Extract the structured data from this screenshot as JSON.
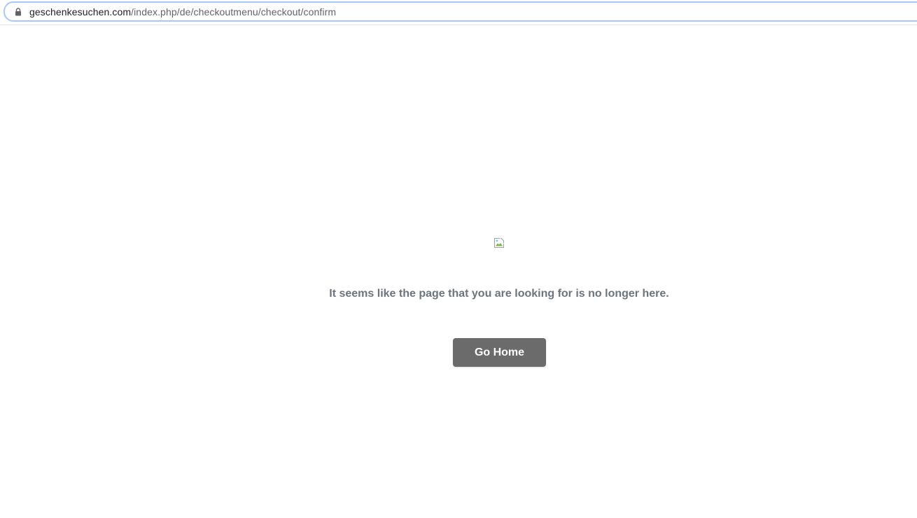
{
  "browser": {
    "url_host": "geschenkesuchen.com",
    "url_path": "/index.php/de/checkoutmenu/checkout/confirm",
    "lock_icon": "lock-icon"
  },
  "error_page": {
    "image_icon": "broken-image-icon",
    "message": "It seems like the page that you are looking for is no longer here.",
    "go_home_label": "Go Home",
    "button_color": "#6b6b6b",
    "message_color": "#6c757d"
  }
}
